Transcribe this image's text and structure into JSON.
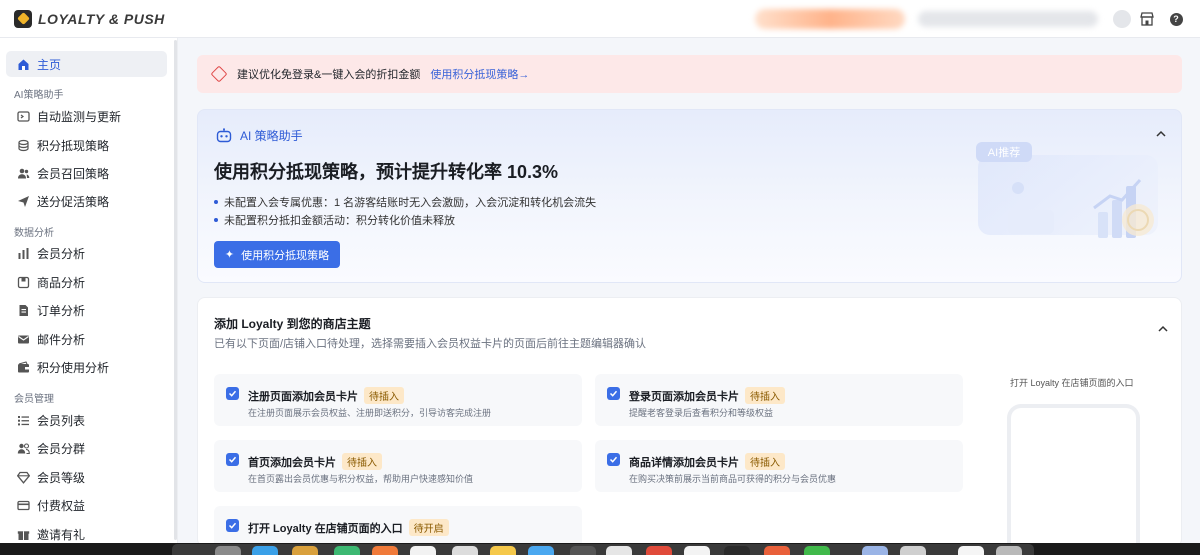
{
  "app": {
    "name": "LOYALTY & PUSH"
  },
  "icons": {
    "logo": "logo-icon",
    "store": "store-icon",
    "help": "help-icon"
  },
  "sidebar": {
    "home": "主页",
    "groups": {
      "ai": "AI策略助手",
      "data": "数据分析",
      "members": "会员管理"
    },
    "ai_items": [
      "自动监测与更新",
      "积分抵现策略",
      "会员召回策略",
      "送分促活策略"
    ],
    "data_items": [
      "会员分析",
      "商品分析",
      "订单分析",
      "邮件分析",
      "积分使用分析"
    ],
    "member_items": [
      "会员列表",
      "会员分群",
      "会员等级",
      "付费权益",
      "邀请有礼"
    ]
  },
  "alert": {
    "text": "建议优化免登录&一键入会的折扣金额",
    "link": "使用积分抵现策略→"
  },
  "ai_card": {
    "header": "AI 策略助手",
    "title": "使用积分抵现策略，预计提升转化率 10.3%",
    "bullets": [
      "未配置入会专属优惠：1 名游客结账时无入会激励，入会沉淀和转化机会流失",
      "未配置积分抵扣金额活动：积分转化价值未释放"
    ],
    "button": "使用积分抵现策略",
    "illustration_badge": "AI推荐"
  },
  "theme_card": {
    "title": "添加 Loyalty 到您的商店主题",
    "subtitle": "已有以下页面/店铺入口待处理，选择需要插入会员权益卡片的页面后前往主题编辑器确认",
    "preview_label": "打开 Loyalty 在店铺页面的入口",
    "tasks": [
      {
        "title": "注册页面添加会员卡片",
        "badge": "待插入",
        "desc": "在注册页面展示会员权益、注册即送积分，引导访客完成注册",
        "checked": true
      },
      {
        "title": "登录页面添加会员卡片",
        "badge": "待插入",
        "desc": "提醒老客登录后查看积分和等级权益",
        "checked": true
      },
      {
        "title": "首页添加会员卡片",
        "badge": "待插入",
        "desc": "在首页露出会员优惠与积分权益，帮助用户快速感知价值",
        "checked": true
      },
      {
        "title": "商品详情添加会员卡片",
        "badge": "待插入",
        "desc": "在购买决策前展示当前商品可获得的积分与会员优惠",
        "checked": true
      },
      {
        "title": "打开 Loyalty 在店铺页面的入口",
        "badge": "待开启",
        "desc": "",
        "checked": true
      }
    ]
  },
  "colors": {
    "accent": "#3b6ee6",
    "alert_bg": "#fde8e8",
    "badge_bg": "#fde8c8"
  }
}
